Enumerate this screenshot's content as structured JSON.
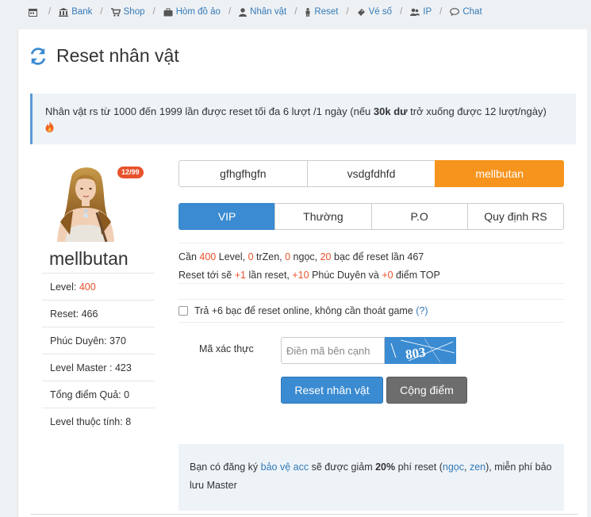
{
  "nav": {
    "items": [
      {
        "label": "",
        "icon": "calendar-icon"
      },
      {
        "label": "Bank",
        "icon": "bank-icon"
      },
      {
        "label": "Shop",
        "icon": "cart-icon"
      },
      {
        "label": "Hòm đồ ảo",
        "icon": "briefcase-icon"
      },
      {
        "label": "Nhân vật",
        "icon": "user-icon"
      },
      {
        "label": "Reset",
        "icon": "male-icon"
      },
      {
        "label": "Vé số",
        "icon": "ticket-icon"
      },
      {
        "label": "IP",
        "icon": "users-icon"
      },
      {
        "label": "Chat",
        "icon": "chat-icon"
      }
    ]
  },
  "page": {
    "title": "Reset nhân vật"
  },
  "alert": {
    "part1": "Nhân vật rs từ 1000 đến 1999 lần được reset tối đa 6 lượt /1 ngày (nếu ",
    "bold": "30k dư",
    "part2": " trở xuống được 12 lượt/ngày)"
  },
  "character": {
    "badge": "12/99",
    "name": "mellbutan",
    "stats": [
      {
        "label": "Level: ",
        "value": "400",
        "highlight": true
      },
      {
        "label": "Reset: ",
        "value": "466",
        "highlight": false
      },
      {
        "label": "Phúc Duyên: ",
        "value": "370",
        "highlight": false
      },
      {
        "label": "Level Master : ",
        "value": "423",
        "highlight": false
      },
      {
        "label": "Tổng điểm Quả: ",
        "value": "0",
        "highlight": false
      },
      {
        "label": "Level thuộc tính: ",
        "value": "8",
        "highlight": false
      }
    ]
  },
  "char_tabs": {
    "items": [
      "gfhgfhgfn",
      "vsdgfdhfd",
      "mellbutan"
    ],
    "active": 2
  },
  "mode_tabs": {
    "items": [
      "VIP",
      "Thường",
      "P.O",
      "Quy định RS"
    ],
    "active": 0
  },
  "requirements": {
    "l1_a": "Cần ",
    "level": "400",
    "l1_b": " Level, ",
    "zen": "0",
    "l1_c": " trZen, ",
    "ngoc": "0",
    "l1_d": " ngọc, ",
    "bac": "20",
    "l1_e": " bạc để reset lần 467",
    "l2_a": "Reset tới sẽ ",
    "plus_reset": "+1",
    "l2_b": " lần reset, ",
    "plus_pd": "+10",
    "l2_c": " Phúc Duyên và ",
    "plus_top": "+0",
    "l2_d": " điểm TOP"
  },
  "online_option": {
    "label": "Trả +6 bạc để reset online, không cần thoát game ",
    "help": "(?)"
  },
  "captcha": {
    "label": "Mã xác thực",
    "placeholder": "Điền mã bên cạnh",
    "code": "803"
  },
  "actions": {
    "reset": "Reset nhân vật",
    "add_points": "Cộng điểm"
  },
  "info": {
    "a": "Bạn có đăng ký ",
    "link": "bảo vệ acc",
    "b": " sẽ được giảm ",
    "pct": "20%",
    "c": " phí reset (",
    "ngoc": "ngọc",
    "comma": ", ",
    "zen": "zen",
    "d": "), miễn phí bảo lưu Master"
  },
  "colors": {
    "accent_blue": "#3a8bd1",
    "accent_orange": "#f7941d",
    "highlight_red": "#e8522b"
  }
}
